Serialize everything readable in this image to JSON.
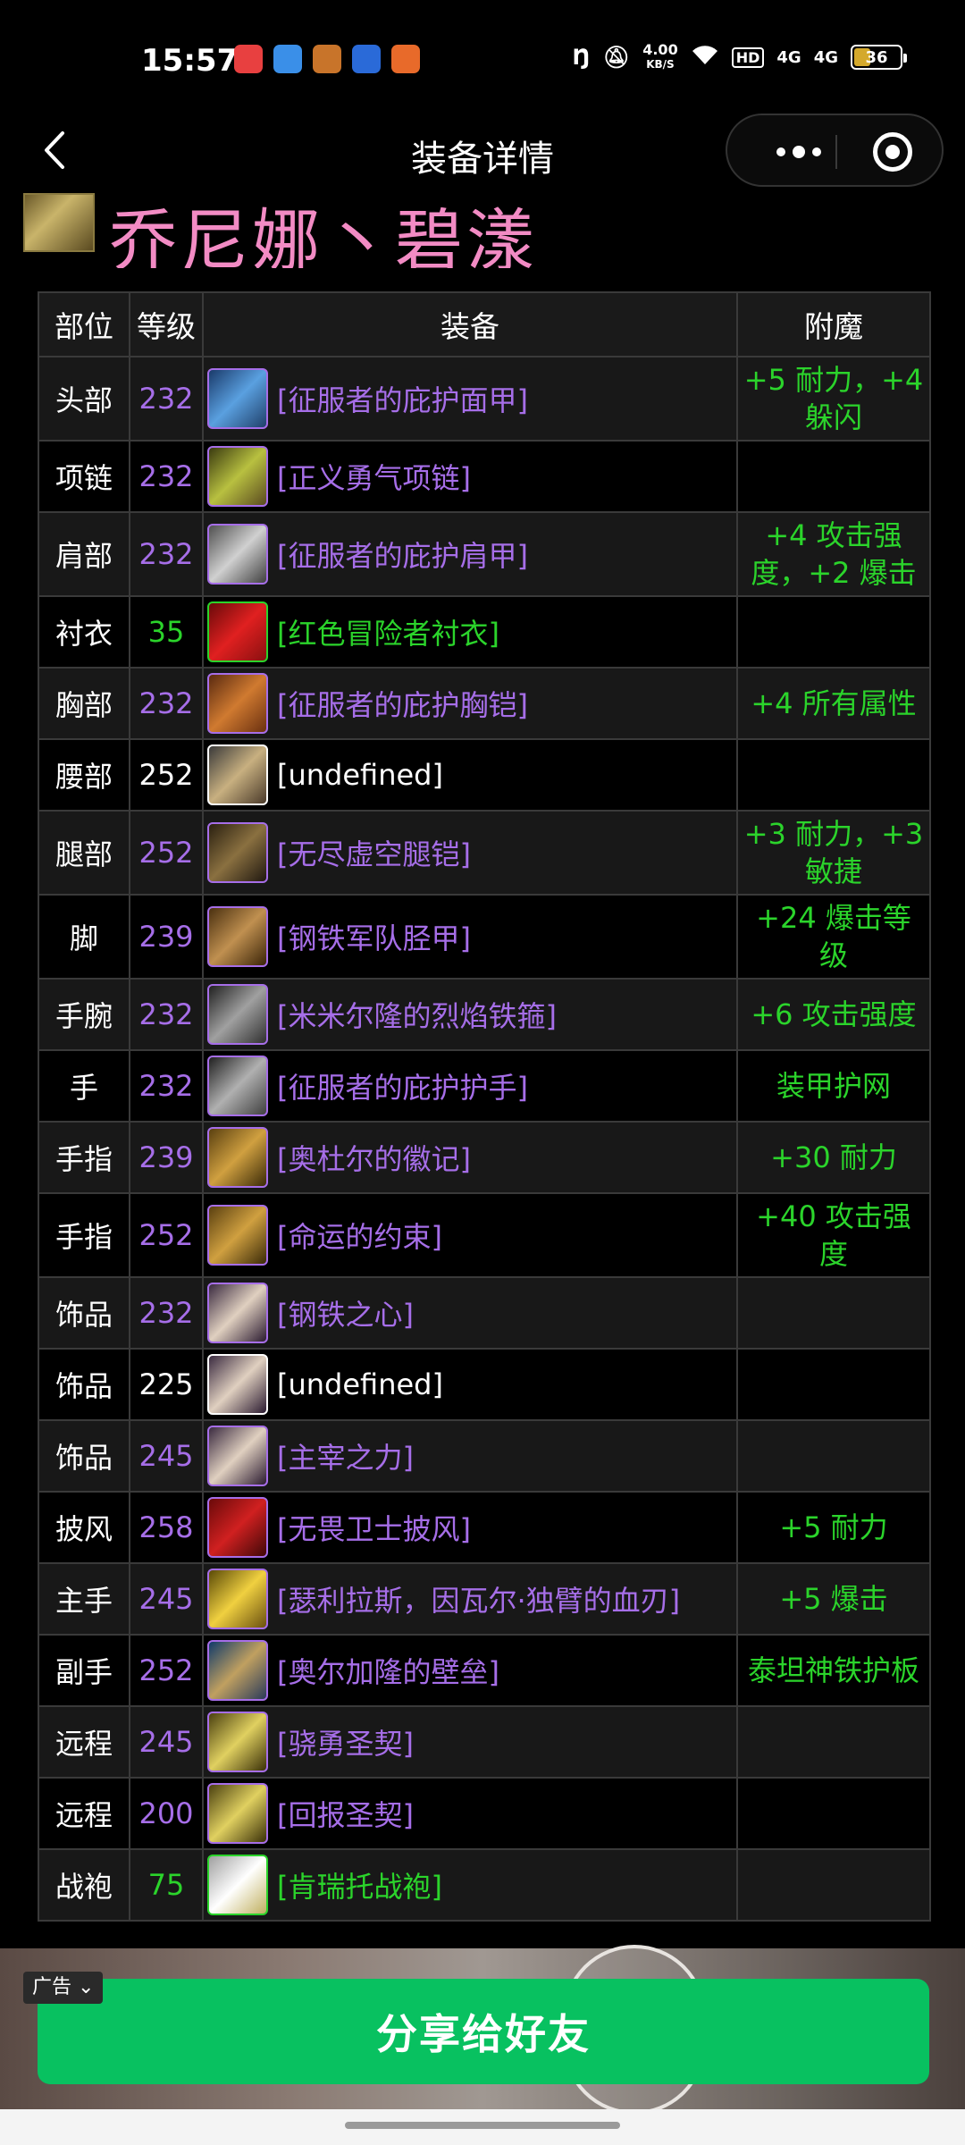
{
  "status_bar": {
    "time": "15:57",
    "net_speed_value": "4.00",
    "net_speed_unit": "KB/S",
    "hd_label": "HD",
    "signal1": "4G",
    "signal2": "4G",
    "battery": "36"
  },
  "nav": {
    "title": "装备详情"
  },
  "character": {
    "name": "乔尼娜丶碧漾"
  },
  "table": {
    "headers": [
      "部位",
      "等级",
      "装备",
      "附魔"
    ],
    "rows": [
      {
        "slot": "头部",
        "level": "232",
        "item": "[征服者的庇护面甲]",
        "enchant": "+5 耐力，+4 躲闪",
        "quality": "purple",
        "icon": "helmet-icon"
      },
      {
        "slot": "项链",
        "level": "232",
        "item": "[正义勇气项链]",
        "enchant": "",
        "quality": "purple",
        "icon": "necklace-icon"
      },
      {
        "slot": "肩部",
        "level": "232",
        "item": "[征服者的庇护肩甲]",
        "enchant": "+4 攻击强度，+2 爆击",
        "quality": "purple",
        "icon": "shoulder-icon"
      },
      {
        "slot": "衬衣",
        "level": "35",
        "item": "[红色冒险者衬衣]",
        "enchant": "",
        "quality": "green",
        "icon": "shirt-icon"
      },
      {
        "slot": "胸部",
        "level": "232",
        "item": "[征服者的庇护胸铠]",
        "enchant": "+4 所有属性",
        "quality": "purple",
        "icon": "chest-icon"
      },
      {
        "slot": "腰部",
        "level": "252",
        "item": "[undefined]",
        "enchant": "",
        "quality": "white",
        "icon": "waist-icon"
      },
      {
        "slot": "腿部",
        "level": "252",
        "item": "[无尽虚空腿铠]",
        "enchant": "+3 耐力，+3 敏捷",
        "quality": "purple",
        "icon": "legs-icon"
      },
      {
        "slot": "脚",
        "level": "239",
        "item": "[钢铁军队胫甲]",
        "enchant": "+24 爆击等级",
        "quality": "purple",
        "icon": "boots-icon"
      },
      {
        "slot": "手腕",
        "level": "232",
        "item": "[米米尔隆的烈焰铁箍]",
        "enchant": "+6 攻击强度",
        "quality": "purple",
        "icon": "wrist-icon"
      },
      {
        "slot": "手",
        "level": "232",
        "item": "[征服者的庇护护手]",
        "enchant": "装甲护网",
        "quality": "purple",
        "icon": "gloves-icon"
      },
      {
        "slot": "手指",
        "level": "239",
        "item": "[奥杜尔的徽记]",
        "enchant": "+30 耐力",
        "quality": "purple",
        "icon": "ring-icon"
      },
      {
        "slot": "手指",
        "level": "252",
        "item": "[命运的约束]",
        "enchant": "+40 攻击强度",
        "quality": "purple",
        "icon": "ring-icon"
      },
      {
        "slot": "饰品",
        "level": "232",
        "item": "[钢铁之心]",
        "enchant": "",
        "quality": "purple",
        "icon": "trinket-icon"
      },
      {
        "slot": "饰品",
        "level": "225",
        "item": "[undefined]",
        "enchant": "",
        "quality": "white",
        "icon": "trinket-icon"
      },
      {
        "slot": "饰品",
        "level": "245",
        "item": "[主宰之力]",
        "enchant": "",
        "quality": "purple",
        "icon": "trinket-icon"
      },
      {
        "slot": "披风",
        "level": "258",
        "item": "[无畏卫士披风]",
        "enchant": "+5 耐力",
        "quality": "purple",
        "icon": "cloak-icon"
      },
      {
        "slot": "主手",
        "level": "245",
        "item": "[瑟利拉斯，因瓦尔·独臂的血刃]",
        "enchant": "+5 爆击",
        "quality": "purple",
        "icon": "sword-icon"
      },
      {
        "slot": "副手",
        "level": "252",
        "item": "[奥尔加隆的壁垒]",
        "enchant": "泰坦神铁护板",
        "quality": "purple",
        "icon": "shield-icon"
      },
      {
        "slot": "远程",
        "level": "245",
        "item": "[骁勇圣契]",
        "enchant": "",
        "quality": "purple",
        "icon": "libram-icon"
      },
      {
        "slot": "远程",
        "level": "200",
        "item": "[回报圣契]",
        "enchant": "",
        "quality": "purple",
        "icon": "libram-icon"
      },
      {
        "slot": "战袍",
        "level": "75",
        "item": "[肯瑞托战袍]",
        "enchant": "",
        "quality": "green",
        "icon": "tabard-icon"
      }
    ]
  },
  "ad": {
    "tag": "广告 ⌄"
  },
  "share_button": "分享给好友",
  "colors": {
    "purple": "#a66ee8",
    "green": "#2bd42b",
    "pink_name": "#f28bc4",
    "share_green": "#08c160"
  }
}
